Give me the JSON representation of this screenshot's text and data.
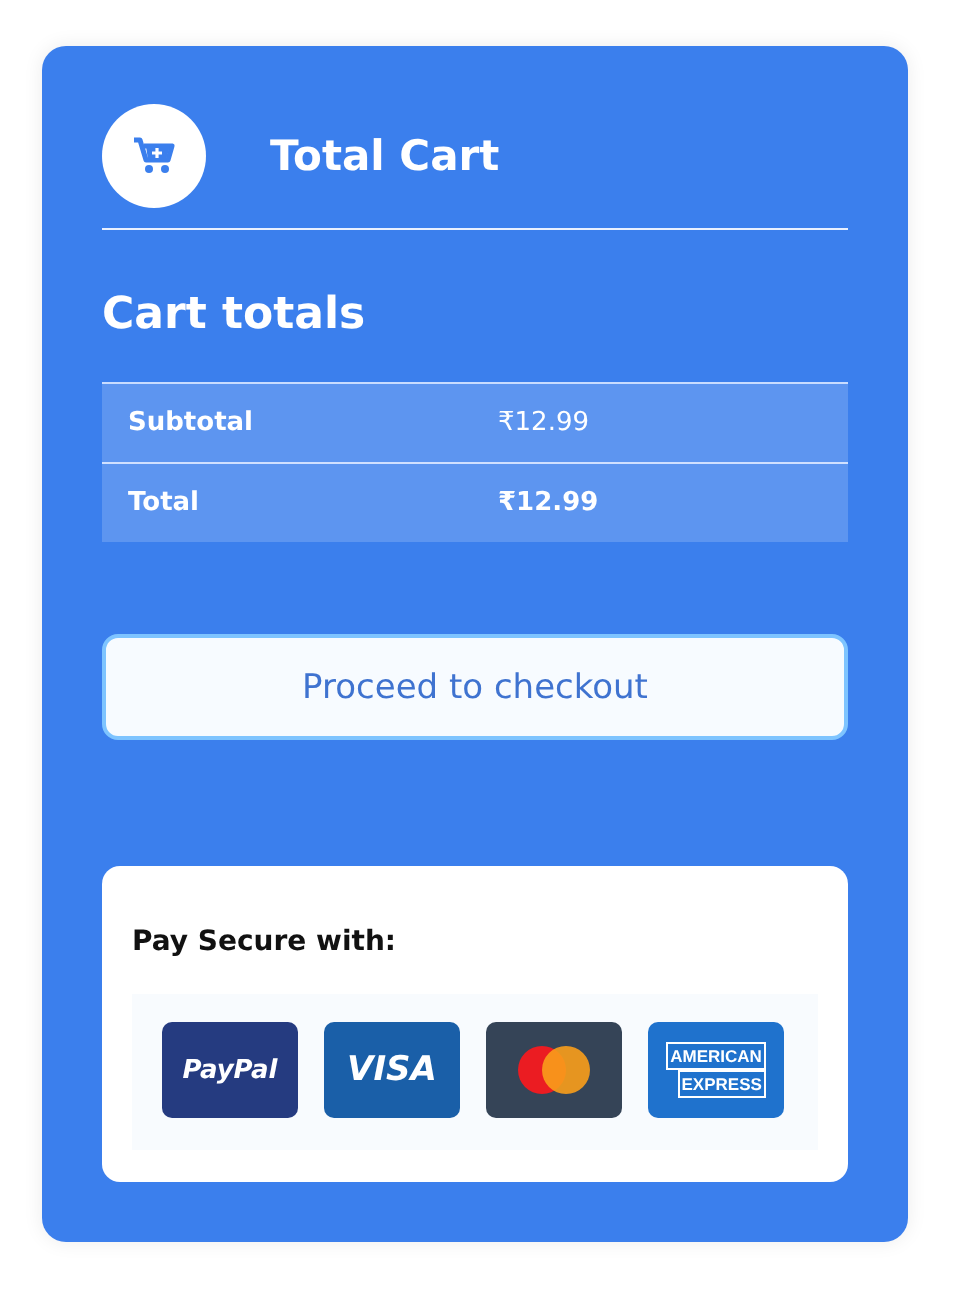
{
  "header": {
    "title": "Total Cart"
  },
  "heading": "Cart totals",
  "totals": [
    {
      "label": "Subtotal",
      "value": "₹12.99",
      "bold": false
    },
    {
      "label": "Total",
      "value": "₹12.99",
      "bold": true
    }
  ],
  "checkout_button": "Proceed to checkout",
  "payment": {
    "title": "Pay Secure with:",
    "cards": [
      {
        "kind": "paypal",
        "text": "PayPal"
      },
      {
        "kind": "visa",
        "text": "VISA"
      },
      {
        "kind": "mastercard"
      },
      {
        "kind": "amex",
        "lines": [
          "AMERICAN",
          "EXPRESS"
        ]
      }
    ]
  }
}
